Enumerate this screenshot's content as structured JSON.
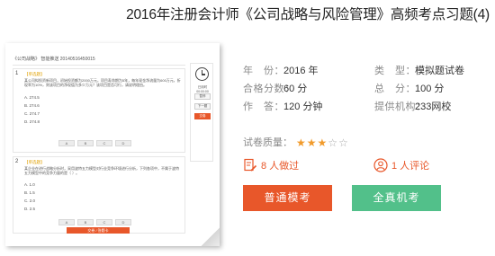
{
  "page_title": "2016年注册会计师《公司战略与风险管理》高频考点习题(4)",
  "preview": {
    "header": "《公司战略》 智能推送 20140516450015",
    "q1": {
      "num": "1",
      "tag": "【单选题】",
      "text": "某公司拟投资新项目，初始投资额为2000万元，项目寿命期为5年，每年现金净流量为600万元，折现率为10%，则该项目的净现值为多少万元？该项目是否可行，请说明理由。",
      "options": [
        "A. 274.5",
        "B. 274.6",
        "C. 274.7",
        "D. 274.8"
      ],
      "answers": [
        "A",
        "B",
        "C",
        "D"
      ]
    },
    "q2": {
      "num": "2",
      "tag": "【单选题】",
      "text": "某企业在进行战略分析时，采用波特五力模型对行业竞争环境进行分析，下列各项中，不属于波特五力模型中的竞争力量的是（ ）。",
      "options": [
        "A. 1.0",
        "B. 1.5",
        "C. 2.0",
        "D. 2.5"
      ],
      "answers": [
        "A",
        "B",
        "C",
        "D"
      ]
    },
    "bottom_bar": "交卷 / 答题卡",
    "timer": "已用时 00:00:00",
    "side_buttons": [
      "暂停",
      "下一题",
      "交卷"
    ]
  },
  "info": {
    "year_label": "年　份：",
    "year_value": "2016 年",
    "type_label": "类　型：",
    "type_value": "模拟题试卷",
    "pass_label": "合格分数：",
    "pass_value": "60 分",
    "total_label": "总　分：",
    "total_value": "100 分",
    "time_label": "作　答：",
    "time_value": "120 分钟",
    "org_label": "提供机构：",
    "org_value": "233网校"
  },
  "rating": {
    "label": "试卷质量：",
    "stars_filled": 3,
    "stars_total": 5
  },
  "stats": {
    "done_count": "8 人做过",
    "comment_count": "1 人评论"
  },
  "buttons": {
    "normal": "普通模考",
    "real": "全真机考"
  },
  "colors": {
    "accent_orange": "#e8572a",
    "accent_green": "#52c08a",
    "star": "#f19b2c"
  }
}
